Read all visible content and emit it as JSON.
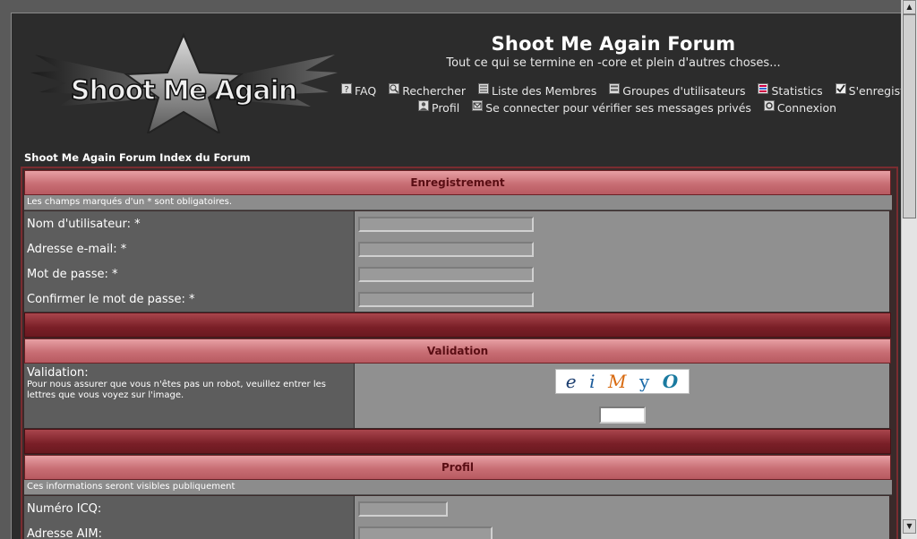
{
  "header": {
    "logo_text": "Shoot Me Again",
    "title": "Shoot Me Again Forum",
    "description": "Tout ce qui se termine en -core et plein d'autres choses..."
  },
  "nav": {
    "row1": [
      {
        "label": "FAQ",
        "icon": "help-icon"
      },
      {
        "label": "Rechercher",
        "icon": "search-icon"
      },
      {
        "label": "Liste des Membres",
        "icon": "members-icon"
      },
      {
        "label": "Groupes d'utilisateurs",
        "icon": "groups-icon"
      },
      {
        "label": "Statistics",
        "icon": "statistics-icon"
      },
      {
        "label": "S'enregistrer",
        "icon": "register-icon"
      }
    ],
    "row2": [
      {
        "label": "Profil",
        "icon": "profile-icon"
      },
      {
        "label": "Se connecter pour vérifier ses messages privés",
        "icon": "messages-icon"
      },
      {
        "label": "Connexion",
        "icon": "login-icon"
      }
    ]
  },
  "breadcrumb": "Shoot Me Again Forum Index du Forum",
  "registration": {
    "header": "Enregistrement",
    "note": "Les champs marqués d'un * sont obligatoires.",
    "fields": [
      {
        "label": "Nom d'utilisateur: *",
        "value": ""
      },
      {
        "label": "Adresse e-mail: *",
        "value": ""
      },
      {
        "label": "Mot de passe: *",
        "value": ""
      },
      {
        "label": "Confirmer le mot de passe: *",
        "value": ""
      }
    ]
  },
  "validation": {
    "header": "Validation",
    "label": "Validation:",
    "help": "Pour nous assurer que vous n'êtes pas un robot, veuillez entrer les lettres que vous voyez sur l'image.",
    "captcha_chars": [
      "e",
      "i",
      "M",
      "y",
      "O"
    ],
    "captcha_colors": [
      "#1a3c6e",
      "#1a5a9a",
      "#d86a10",
      "#1a6aa8",
      "#1a7aa0"
    ],
    "input_value": ""
  },
  "profile": {
    "header": "Profil",
    "note": "Ces informations seront visibles publiquement",
    "fields": [
      {
        "label": "Numéro ICQ:",
        "value": ""
      },
      {
        "label": "Adresse AIM:",
        "value": ""
      }
    ]
  }
}
